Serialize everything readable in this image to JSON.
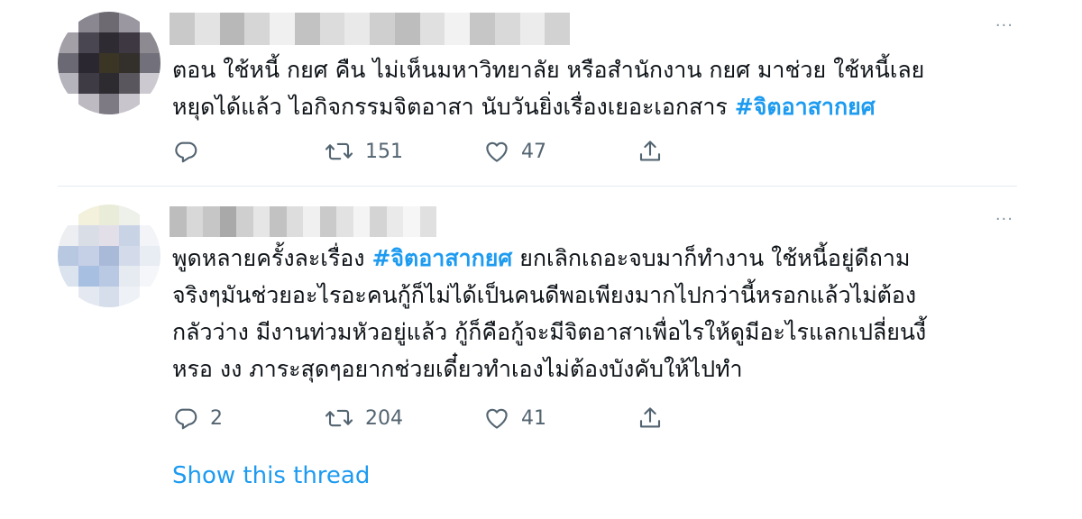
{
  "tweets": [
    {
      "text_before": "ตอน ใช้หนี้ กยศ คืน ไม่เห็นมหาวิทยาลัย หรือสำนักงาน กยศ มาช่วย ใช้หนี้เลย\nหยุดได้แล้ว ไอกิจกรรมจิตอาสา นับวันยิ่งเรื่องเยอะเอกสาร ",
      "hashtag": "#จิตอาสากยศ",
      "text_after": "",
      "reply_count": "",
      "retweet_count": "151",
      "like_count": "47",
      "avatar_colors": [
        "#ffffff",
        "#8b8790",
        "#6e6a72",
        "#9a97a0",
        "#ffffff",
        "#a4a0a8",
        "#4a4651",
        "#2f2b33",
        "#3d3841",
        "#8d8a92",
        "#6b6a74",
        "#2a2730",
        "#3a3524",
        "#332f2a",
        "#72707a",
        "#b5b3bb",
        "#3e3b44",
        "#2d2a30",
        "#59565e",
        "#ccc9d0",
        "#ffffff",
        "#bdbac2",
        "#7d7a83",
        "#c8c5cc",
        "#ffffff"
      ],
      "name_colors": [
        "#c9c9c9",
        "#e3e3e3",
        "#b8b8b8",
        "#d6d6d6",
        "#f0f0f0",
        "#c2c2c2",
        "#dcdcdc",
        "#e9e9e9",
        "#cfcfcf",
        "#bdbdbd",
        "#e0e0e0",
        "#f2f2f2",
        "#c6c6c6",
        "#d9d9d9",
        "#ececec",
        "#d2d2d2"
      ]
    },
    {
      "text_before": "พูดหลายครั้งละเรื่อง ",
      "hashtag": "#จิตอาสากยศ",
      "text_after": " ยกเลิกเถอะจบมาก็ทำงาน ใช้หนี้อยู่ดีถาม\nจริงๆมันช่วยอะไรอะคนกู้ก็ไม่ได้เป็นคนดีพอเพียงมากไปกว่านี้หรอกแล้วไม่ต้อง\nกลัวว่าง มีงานท่วมหัวอยู่แล้ว กู้ก็คือกู้จะมีจิตอาสาเพื่อไรให้ดูมีอะไรแลกเปลี่ยนงี้\nหรอ งง ภาระสุดๆอยากช่วยเดี๋ยวทำเองไม่ต้องบังคับให้ไปทำ",
      "reply_count": "2",
      "retweet_count": "204",
      "like_count": "41",
      "avatar_colors": [
        "#ffffff",
        "#f3f1dc",
        "#e9ecd8",
        "#eef0ea",
        "#ffffff",
        "#eceef2",
        "#d9dde6",
        "#e2dfe8",
        "#c9d3e6",
        "#f2f4f8",
        "#b7c8e0",
        "#c5d0e6",
        "#a9b9d8",
        "#d3dbea",
        "#e8ecf3",
        "#dbe3ef",
        "#a7bfe0",
        "#b9c9e4",
        "#e6ebf2",
        "#f4f6f9",
        "#ffffff",
        "#e4e9f1",
        "#d5deea",
        "#eef1f6",
        "#ffffff"
      ],
      "name_colors": [
        "#bdbdbd",
        "#d8d8d8",
        "#c6c6c6",
        "#a9a9a9",
        "#cfcfcf",
        "#e6e6e6",
        "#c2c2c2",
        "#dddddd",
        "#f0f0f0",
        "#cacaca",
        "#e2e2e2",
        "#f4f4f4",
        "#d4d4d4",
        "#eaeaea",
        "#f6f6f6",
        "#e0e0e0"
      ]
    }
  ],
  "show_thread_label": "Show this thread",
  "more_icon_glyph": "···",
  "colors": {
    "accent": "#1d9bf0",
    "text": "#0f1419",
    "muted": "#536471",
    "divider": "#e6ecf0"
  }
}
